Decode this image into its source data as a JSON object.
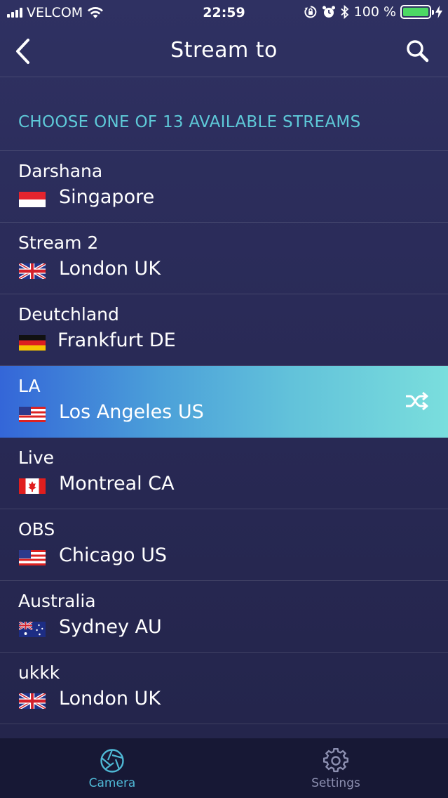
{
  "status_bar": {
    "carrier": "VELCOM",
    "time": "22:59",
    "battery_text": "100 %",
    "battery_level": 1.0
  },
  "nav": {
    "title": "Stream to",
    "back_icon": "chevron-left-icon",
    "search_icon": "search-icon"
  },
  "section_header": "CHOOSE ONE OF 13 AVAILABLE STREAMS",
  "streams": [
    {
      "name": "Darshana",
      "location": "Singapore",
      "flag": "sg"
    },
    {
      "name": "Stream 2",
      "location": "London UK",
      "flag": "gb"
    },
    {
      "name": "Deutchland",
      "location": "Frankfurt DE",
      "flag": "de"
    },
    {
      "name": "LA",
      "location": "Los Angeles US",
      "flag": "us",
      "selected": true
    },
    {
      "name": "Live",
      "location": "Montreal CA",
      "flag": "ca"
    },
    {
      "name": "OBS",
      "location": "Chicago US",
      "flag": "us"
    },
    {
      "name": "Australia",
      "location": "Sydney AU",
      "flag": "au"
    },
    {
      "name": "ukkk",
      "location": "London UK",
      "flag": "gb"
    }
  ],
  "tabs": [
    {
      "label": "Camera",
      "icon": "camera-aperture-icon",
      "active": true
    },
    {
      "label": "Settings",
      "icon": "gear-icon",
      "active": false
    }
  ],
  "colors": {
    "accent": "#5ec9d8",
    "background": "#2a2b58",
    "tab_bar": "#171835",
    "battery": "#4cd964"
  }
}
